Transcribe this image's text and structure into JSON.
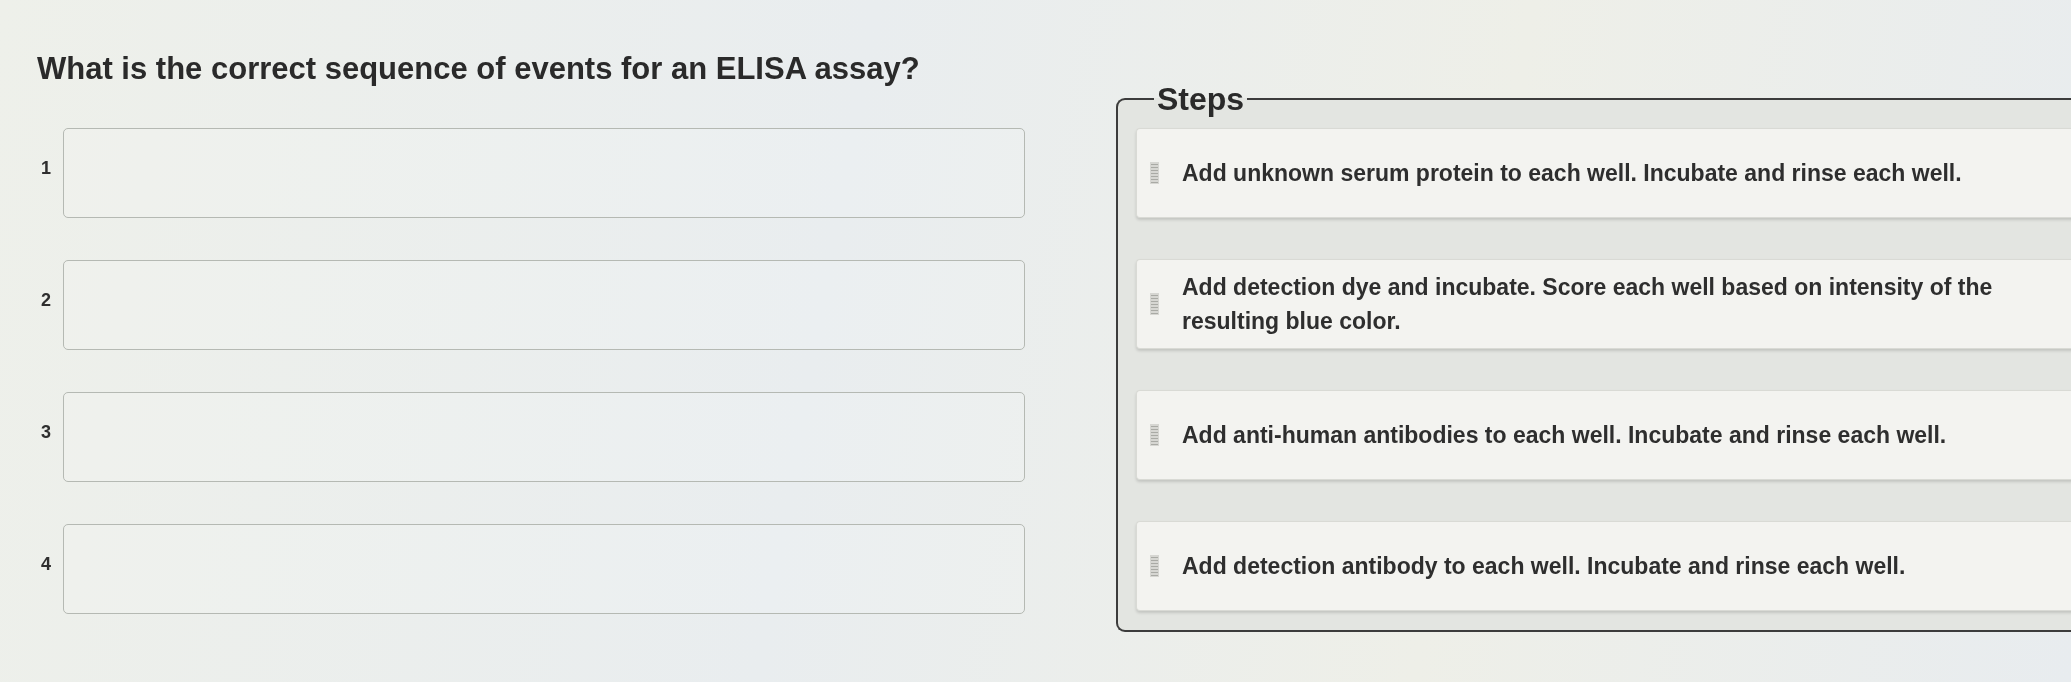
{
  "question": "What is the correct sequence of events for an ELISA assay?",
  "answer_slots": [
    {
      "number": "1"
    },
    {
      "number": "2"
    },
    {
      "number": "3"
    },
    {
      "number": "4"
    }
  ],
  "steps_panel": {
    "legend": "Steps",
    "items": [
      {
        "text": "Add unknown serum protein to each well. Incubate and rinse each well."
      },
      {
        "text": "Add detection dye and incubate. Score each well based on intensity of the resulting blue color."
      },
      {
        "text": "Add anti-human antibodies to each well. Incubate and rinse each well."
      },
      {
        "text": "Add detection antibody to each well. Incubate and rinse each well."
      }
    ]
  }
}
